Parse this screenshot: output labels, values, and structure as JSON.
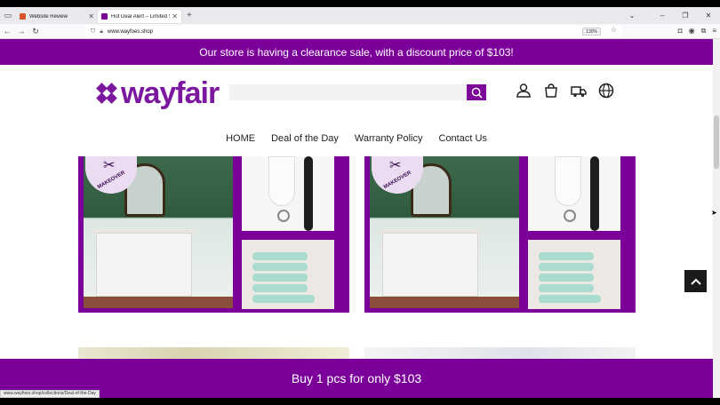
{
  "browser": {
    "tabs": [
      {
        "title": "Website Review",
        "favicon_color": "#d9532b"
      },
      {
        "title": "Hot Deal Alert – Limited Stock",
        "favicon_color": "#7b0099"
      }
    ],
    "url_host": "www.wayfoes.shop",
    "zoom": "130%",
    "status_url": "www.wayfoes.shop/collections/Deal-of-the-Day"
  },
  "page": {
    "promo_top": "Our store is having a clearance sale, with a discount price of $103!",
    "logo_text": "wayfair",
    "menu": [
      "HOME",
      "Deal of the Day",
      "Warranty Policy",
      "Contact Us"
    ],
    "badge_text": "MAKEOVER",
    "promo_bottom": "Buy 1 pcs for only $103",
    "brand_color": "#7b0099"
  }
}
